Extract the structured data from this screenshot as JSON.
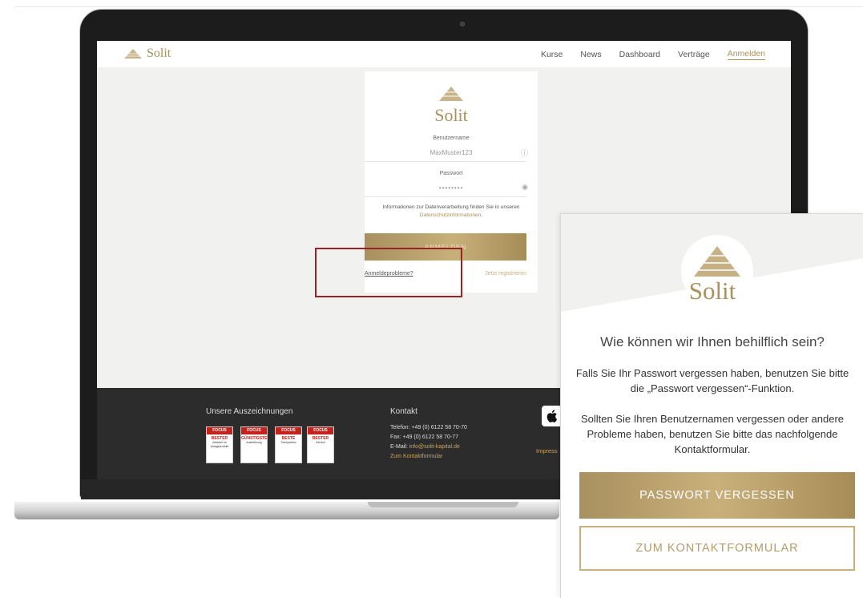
{
  "nav": {
    "brand": "Solit",
    "links": [
      "Kurse",
      "News",
      "Dashboard",
      "Verträge",
      "Anmelden"
    ]
  },
  "login": {
    "brand": "Solit",
    "username_label": "Benutzername",
    "username_value": "MaxMuster123",
    "password_label": "Passwort",
    "password_value": "••••••••",
    "info_text": "Informationen zur Datenverarbeitung finden Sie in unseren",
    "info_link": "Datenschutzinformationen",
    "info_end": ".",
    "submit": "ANMELDEN",
    "problems_link": "Anmeldeprobleme?",
    "register_link": "Jetzt registrieren"
  },
  "footer": {
    "awards_title": "Unsere Auszeichnungen",
    "awards": [
      {
        "main": "BESTER",
        "sub": "Anbieter im Anlageprodukt"
      },
      {
        "main": "GÜNSTIGSTE",
        "sub": "Auslieferung"
      },
      {
        "main": "BESTE",
        "sub": "Transparenz"
      },
      {
        "main": "BESTER",
        "sub": "Service"
      }
    ],
    "contact_title": "Kontakt",
    "phone": "Telefon: +49 (0) 6122 58 70-70",
    "fax": "Fax: +49 (0) 6122 58 70-77",
    "email_label": "E-Mail: ",
    "email": "info@solit-kapital.de",
    "contact_form": "Zum Kontaktformular",
    "impress": "Impress"
  },
  "popup": {
    "brand": "Solit",
    "heading": "Wie können wir Ihnen behilflich sein?",
    "para1": "Falls Sie Ihr Passwort vergessen haben, benutzen Sie bitte die „Passwort vergessen“-Funktion.",
    "para2": "Sollten Sie Ihren Benutzernamen vergessen oder andere Probleme haben, benutzen Sie bitte das nachfolgende Kontaktformular.",
    "btn_primary": "PASSWORT VERGESSEN",
    "btn_secondary": "ZUM KONTAKTFORMULAR"
  },
  "colors": {
    "gold": "#a8905f",
    "dark": "#2c2c2c",
    "highlight": "#9b2222"
  }
}
